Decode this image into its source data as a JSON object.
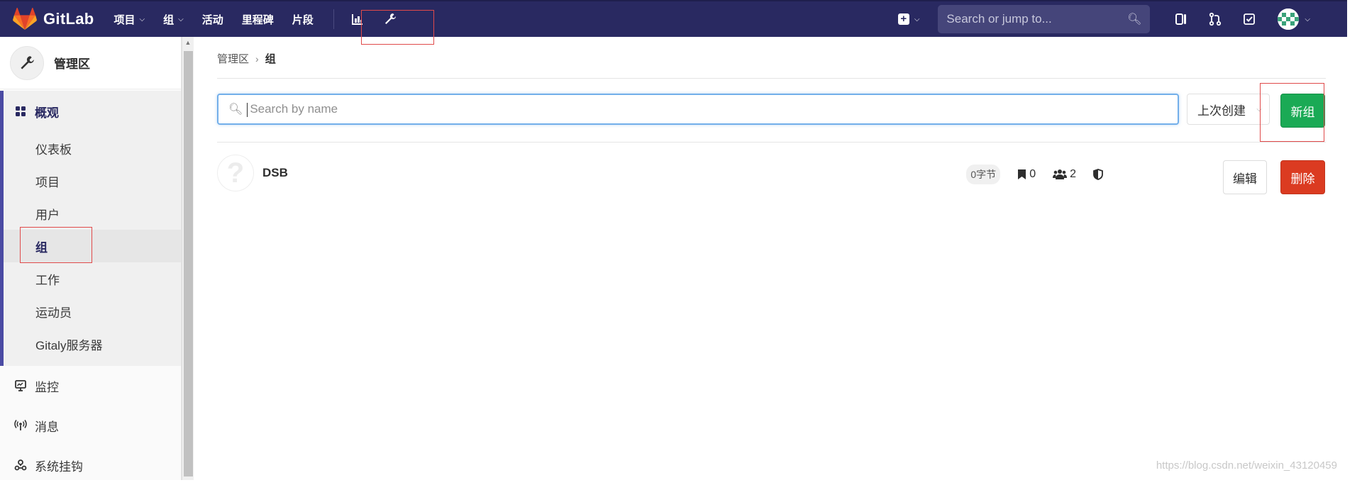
{
  "navbar": {
    "brand": "GitLab",
    "items": [
      {
        "label": "项目",
        "dropdown": true
      },
      {
        "label": "组",
        "dropdown": true
      },
      {
        "label": "活动",
        "dropdown": false
      },
      {
        "label": "里程碑",
        "dropdown": false
      },
      {
        "label": "片段",
        "dropdown": false
      }
    ],
    "icons": [
      "chart-icon",
      "wrench-icon"
    ],
    "search_placeholder": "Search or jump to...",
    "right_icons": [
      "plus-icon",
      "issues-icon",
      "merge-request-icon",
      "todo-icon",
      "avatar"
    ],
    "chevron": "⌄"
  },
  "sidebar": {
    "title": "管理区",
    "group": {
      "label": "概观",
      "items": [
        {
          "label": "仪表板",
          "active": false
        },
        {
          "label": "项目",
          "active": false
        },
        {
          "label": "用户",
          "active": false
        },
        {
          "label": "组",
          "active": true
        },
        {
          "label": "工作",
          "active": false
        },
        {
          "label": "运动员",
          "active": false
        },
        {
          "label": "Gitaly服务器",
          "active": false
        }
      ]
    },
    "items": [
      {
        "label": "监控",
        "icon": "monitor-icon"
      },
      {
        "label": "消息",
        "icon": "broadcast-icon"
      },
      {
        "label": "系统挂钩",
        "icon": "hook-icon"
      }
    ]
  },
  "breadcrumb": {
    "parent": "管理区",
    "current": "组"
  },
  "filter": {
    "placeholder": "Search by name",
    "sort_label": "上次创建",
    "new_button": "新组"
  },
  "groups": [
    {
      "name": "DSB",
      "avatar_letter": "?",
      "size": "0字节",
      "projects": "0",
      "members": "2",
      "edit_label": "编辑",
      "delete_label": "删除"
    }
  ],
  "watermark": "https://blog.csdn.net/weixin_43120459",
  "colors": {
    "navbar": "#292961",
    "accent": "#4b4ba3",
    "success": "#1aaa55",
    "danger": "#db3b21"
  }
}
